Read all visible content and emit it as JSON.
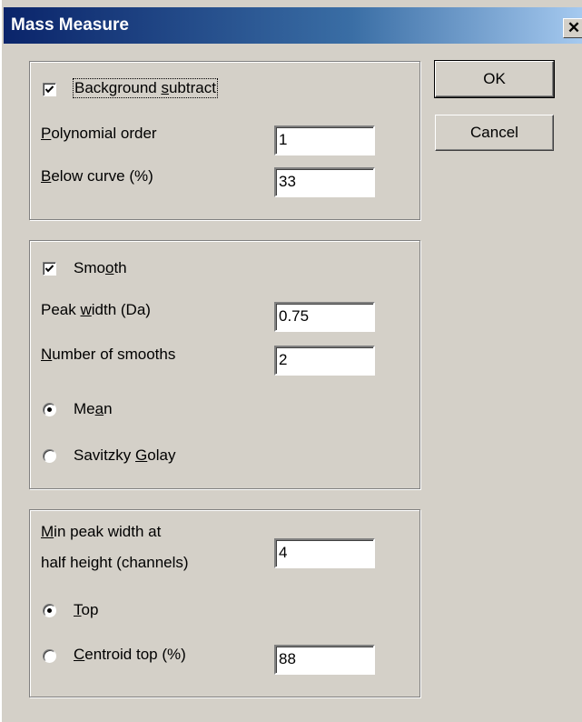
{
  "window": {
    "title": "Mass Measure",
    "close_glyph": "✕",
    "close_icon": "close-icon"
  },
  "buttons": {
    "ok": "OK",
    "cancel": "Cancel"
  },
  "background": {
    "checkbox_label": "Background subtract",
    "checked": true,
    "polynomial_label": "Polynomial order",
    "polynomial_value": "1",
    "below_label": "Below curve (%)",
    "below_value": "33"
  },
  "smooth": {
    "checkbox_label": "Smooth",
    "checked": true,
    "peak_width_label": "Peak width (Da)",
    "peak_width_value": "0.75",
    "num_smooths_label": "Number of smooths",
    "num_smooths_value": "2",
    "mean_label": "Mean",
    "savitzky_label": "Savitzky Golay",
    "selected": "Mean"
  },
  "peak": {
    "min_width_label_line1": "Min peak width at",
    "min_width_label_line2": "half height (channels)",
    "min_width_value": "4",
    "top_label": "Top",
    "centroid_label": "Centroid top (%)",
    "centroid_value": "88",
    "selected": "Top"
  }
}
